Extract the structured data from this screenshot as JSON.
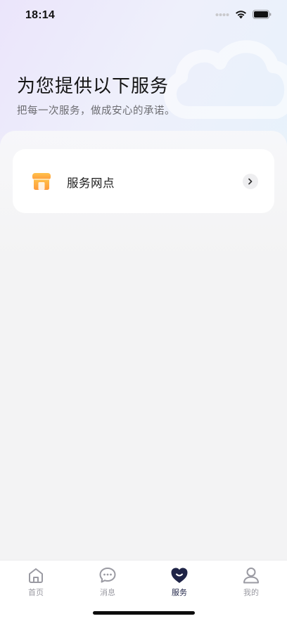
{
  "status_bar": {
    "time": "18:14"
  },
  "hero": {
    "title": "为您提供以下服务",
    "subtitle": "把每一次服务，做成安心的承诺。"
  },
  "services": [
    {
      "label": "服务网点",
      "icon": "store-icon"
    }
  ],
  "tab_bar": {
    "tabs": [
      {
        "label": "首页",
        "icon": "home-icon",
        "active": false
      },
      {
        "label": "消息",
        "icon": "message-icon",
        "active": false
      },
      {
        "label": "服务",
        "icon": "heart-service-icon",
        "active": true
      },
      {
        "label": "我的",
        "icon": "person-icon",
        "active": false
      }
    ]
  },
  "colors": {
    "accent": "#1f2447",
    "store_icon_top": "#ffc24b",
    "store_icon_bottom": "#ff9a3c",
    "inactive_tab": "#9a9aa2"
  }
}
